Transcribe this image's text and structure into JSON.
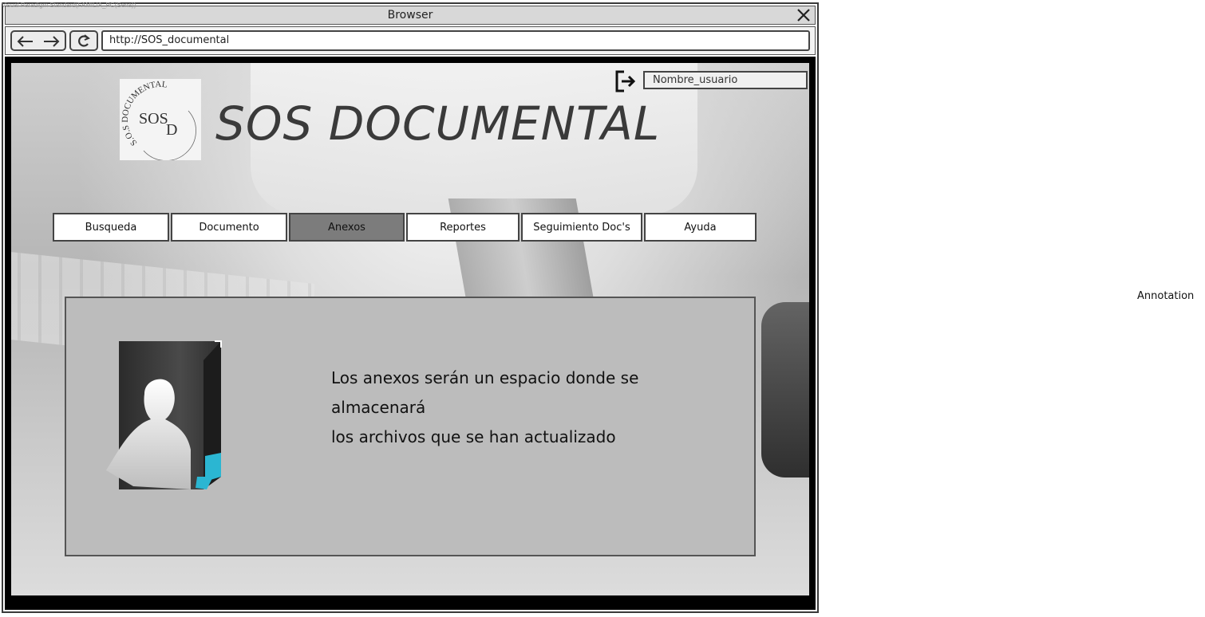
{
  "watermark": "Visual Paradigm Standard(FAMILIA_PC(Sena))",
  "browser": {
    "title": "Browser",
    "url": "http://SOS_documental"
  },
  "header": {
    "logo_ring_text": "S.O.S DOCUMENTAL",
    "logo_center_top": "SOS",
    "logo_center_bottom": "D",
    "app_title": "SOS DOCUMENTAL",
    "username": "Nombre_usuario"
  },
  "menu": {
    "items": [
      {
        "label": "Busqueda",
        "active": false
      },
      {
        "label": "Documento",
        "active": false
      },
      {
        "label": "Anexos",
        "active": true
      },
      {
        "label": "Reportes",
        "active": false
      },
      {
        "label": "Seguimiento Doc's",
        "active": false
      },
      {
        "label": "Ayuda",
        "active": false
      }
    ]
  },
  "panel": {
    "line1": "Los anexos serán un espacio donde se almacenará",
    "line2": "los archivos que se han actualizado"
  },
  "annotation": "Annotation",
  "colors": {
    "active_tab": "#7c7c7c",
    "panel_bg": "#bcbcbc",
    "folder_accent": "#2bb6d2"
  },
  "icons": {
    "close": "close-icon",
    "back": "arrow-left-icon",
    "forward": "arrow-right-icon",
    "reload": "reload-icon",
    "logout": "logout-icon",
    "folder": "user-folder-icon"
  }
}
